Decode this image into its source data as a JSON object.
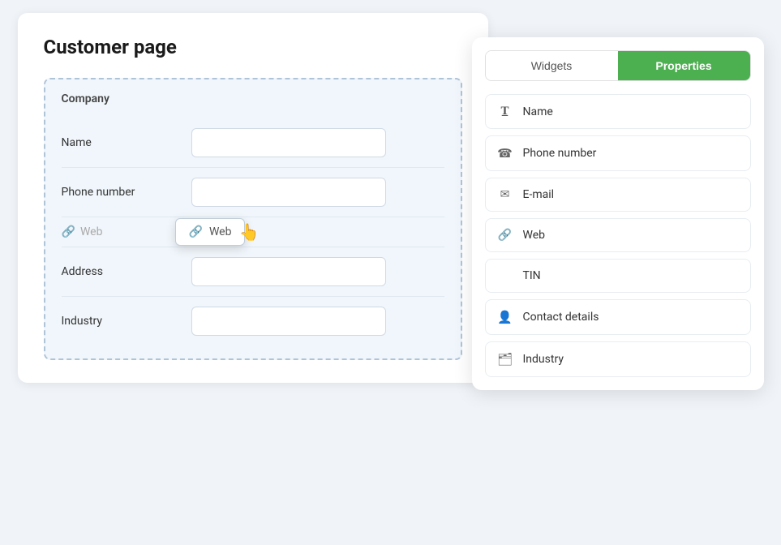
{
  "page": {
    "title": "Customer page"
  },
  "customer_panel": {
    "company_label": "Company",
    "fields": [
      {
        "id": "name",
        "label": "Name",
        "type": "input"
      },
      {
        "id": "phone",
        "label": "Phone number",
        "type": "input"
      },
      {
        "id": "web",
        "label": null,
        "type": "web"
      },
      {
        "id": "address",
        "label": "Address",
        "type": "input"
      },
      {
        "id": "industry",
        "label": "Industry",
        "type": "input"
      }
    ],
    "web_placeholder": "Web",
    "drag_preview_label": "Web"
  },
  "widgets_panel": {
    "tabs": [
      {
        "id": "widgets",
        "label": "Widgets",
        "active": false
      },
      {
        "id": "properties",
        "label": "Properties",
        "active": true
      }
    ],
    "items": [
      {
        "id": "name",
        "label": "Name",
        "icon": "text-format"
      },
      {
        "id": "phone",
        "label": "Phone number",
        "icon": "phone"
      },
      {
        "id": "email",
        "label": "E-mail",
        "icon": "email"
      },
      {
        "id": "web",
        "label": "Web",
        "icon": "link"
      },
      {
        "id": "tin",
        "label": "TIN",
        "icon": "none"
      },
      {
        "id": "contact",
        "label": "Contact details",
        "icon": "contact"
      },
      {
        "id": "industry",
        "label": "Industry",
        "icon": "folder"
      }
    ]
  }
}
